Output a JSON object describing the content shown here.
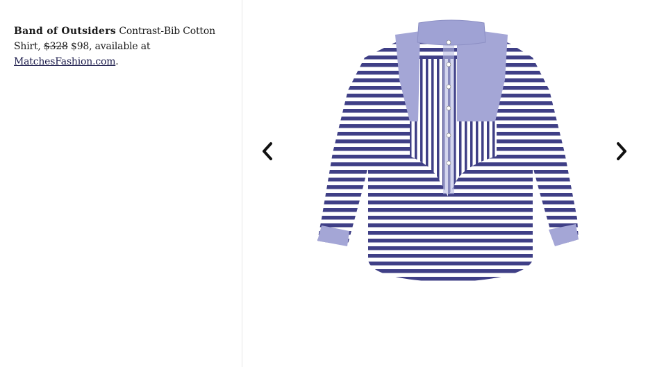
{
  "caption": {
    "brand": "Band of Outsiders",
    "product": " Contrast-Bib Cotton Shirt, ",
    "old_price": "$328",
    "new_price": " $98",
    "availability": ", available at ",
    "retailer_link": "MatchesFashion.com",
    "end_punct": "."
  },
  "gallery": {
    "prev_icon": "chevron-left-icon",
    "next_icon": "chevron-right-icon",
    "image_subject": "blue and white striped shirt with contrast bib"
  },
  "colors": {
    "stripe_blue": "#3f3f86",
    "bib_blue": "#a4a6d6",
    "text": "#1a1a1a",
    "link": "#1a1a4a"
  }
}
